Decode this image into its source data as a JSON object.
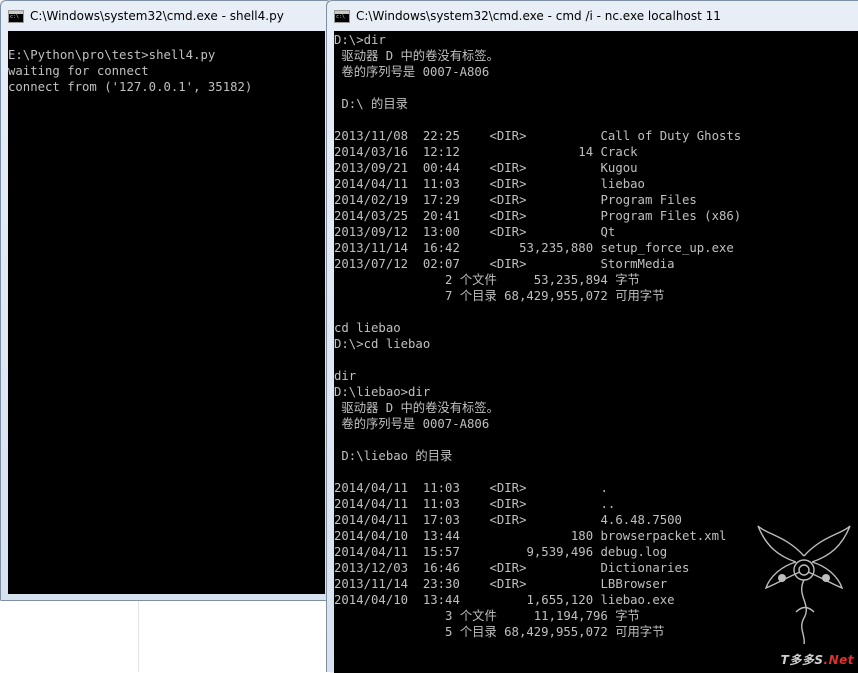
{
  "left_window": {
    "title": "C:\\Windows\\system32\\cmd.exe - shell4.py",
    "lines": [
      "E:\\Python\\pro\\test>shell4.py",
      "waiting for connect",
      "connect from ('127.0.0.1', 35182)"
    ]
  },
  "right_window": {
    "title": "C:\\Windows\\system32\\cmd.exe - cmd  /i - nc.exe  localhost 11",
    "lines": [
      "D:\\>dir",
      " 驱动器 D 中的卷没有标签。",
      " 卷的序列号是 0007-A806",
      "",
      " D:\\ 的目录",
      "",
      "2013/11/08  22:25    <DIR>          Call of Duty Ghosts",
      "2014/03/16  12:12                14 Crack",
      "2013/09/21  00:44    <DIR>          Kugou",
      "2014/04/11  11:03    <DIR>          liebao",
      "2014/02/19  17:29    <DIR>          Program Files",
      "2014/03/25  20:41    <DIR>          Program Files (x86)",
      "2013/09/12  13:00    <DIR>          Qt",
      "2013/11/14  16:42        53,235,880 setup_force_up.exe",
      "2013/07/12  02:07    <DIR>          StormMedia",
      "               2 个文件     53,235,894 字节",
      "               7 个目录 68,429,955,072 可用字节",
      "",
      "cd liebao",
      "D:\\>cd liebao",
      "",
      "dir",
      "D:\\liebao>dir",
      " 驱动器 D 中的卷没有标签。",
      " 卷的序列号是 0007-A806",
      "",
      " D:\\liebao 的目录",
      "",
      "2014/04/11  11:03    <DIR>          .",
      "2014/04/11  11:03    <DIR>          ..",
      "2014/04/11  17:03    <DIR>          4.6.48.7500",
      "2014/04/10  13:44               180 browserpacket.xml",
      "2014/04/11  15:57         9,539,496 debug.log",
      "2013/12/03  16:46    <DIR>          Dictionaries",
      "2013/11/14  23:30    <DIR>          LBBrowser",
      "2014/04/10  13:44         1,655,120 liebao.exe",
      "               3 个文件     11,194,796 字节",
      "               5 个目录 68,429,955,072 可用字节"
    ]
  },
  "watermark": {
    "prefix": "T多多S",
    "dot": ".",
    "suffix": "Net"
  },
  "colors": {
    "console_bg": "#000000",
    "console_text": "#c0c0c0",
    "titlebar": "#dbe6f2",
    "watermark_red": "#e03030"
  },
  "icons": {
    "app_icon": "cmd-console-icon"
  }
}
